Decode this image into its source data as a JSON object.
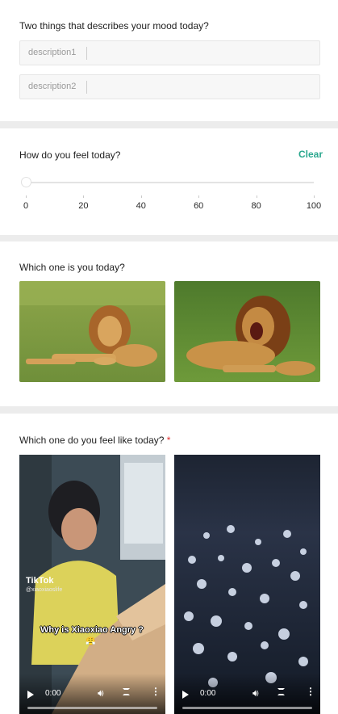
{
  "q1": {
    "title": "Two things that describes your mood today?",
    "field1_placeholder": "description1",
    "field2_placeholder": "description2"
  },
  "q2": {
    "title": "How do you feel today?",
    "clear_label": "Clear",
    "value": 0,
    "ticks": [
      "0",
      "20",
      "40",
      "60",
      "80",
      "100"
    ]
  },
  "q3": {
    "title": "Which one is you today?",
    "options": [
      {
        "image": "lion-lying-calm"
      },
      {
        "image": "lion-roaring"
      }
    ]
  },
  "q4": {
    "title": "Which one do you feel like today?",
    "required_mark": "*",
    "videos": [
      {
        "watermark": "TikTok",
        "handle": "@xiaoxiaoslife",
        "caption": "Why is Xiaoxiao Angry ?",
        "time": "0:00"
      },
      {
        "time": "0:00"
      }
    ]
  },
  "colors": {
    "accent": "#2aa78e",
    "required": "#e02d2d"
  }
}
